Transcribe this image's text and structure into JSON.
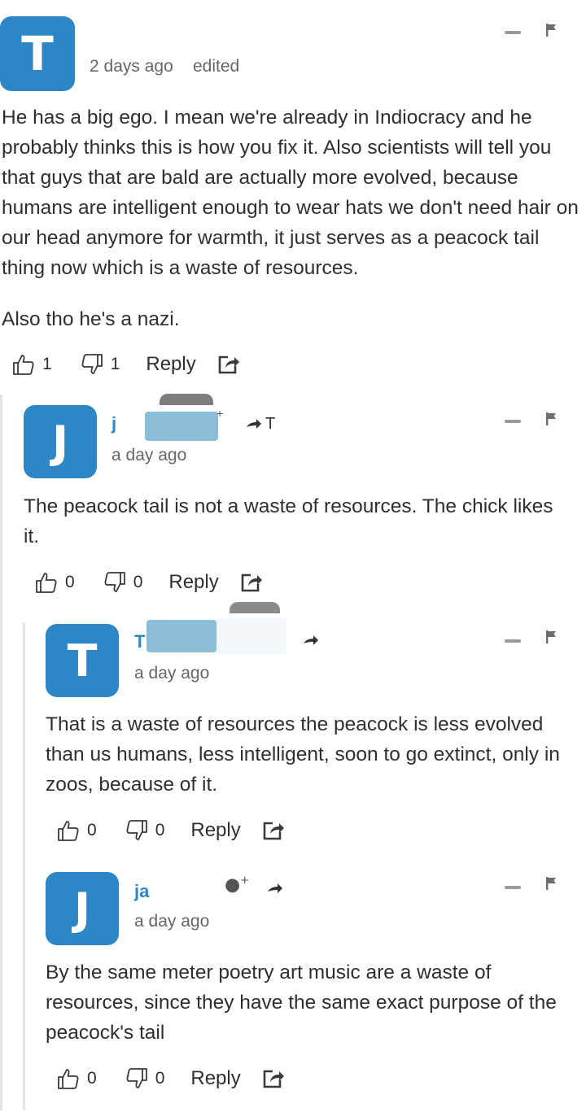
{
  "comments": [
    {
      "avatar_letter": "T",
      "author_visible": "",
      "time": "2 days ago",
      "edited": "edited",
      "body": [
        "He has a big ego. I mean we're already in Indiocracy and he probably thinks this is how you fix it. Also scientists will tell you that guys that are bald are actually more evolved, because humans are intelligent enough to wear hats we don't need hair on our head anymore for warmth, it just serves as a peacock tail thing now which is a waste of resources.",
        "Also tho he's a nazi."
      ],
      "upvotes": "1",
      "downvotes": "1",
      "reply_label": "Reply"
    },
    {
      "avatar_letter": "J",
      "author_visible": "j",
      "reply_to": "T",
      "time": "a day ago",
      "body": [
        "The peacock tail is not a waste of resources. The chick likes it."
      ],
      "upvotes": "0",
      "downvotes": "0",
      "reply_label": "Reply"
    },
    {
      "avatar_letter": "T",
      "author_visible": "T",
      "time": "a day ago",
      "body": [
        "That is a waste of resources the peacock is less evolved than us humans, less intelligent, soon to go extinct, only in zoos, because of it."
      ],
      "upvotes": "0",
      "downvotes": "0",
      "reply_label": "Reply"
    },
    {
      "avatar_letter": "J",
      "author_visible": "ja",
      "time": "a day ago",
      "body": [
        "By the same meter poetry art music are a waste of resources, since they have the same exact purpose of the peacock's tail"
      ],
      "upvotes": "0",
      "downvotes": "0",
      "reply_label": "Reply"
    }
  ],
  "icons": {
    "thumb_up": "thumb-up-icon",
    "thumb_down": "thumb-down-icon",
    "share": "share-icon",
    "reply_arrow": "reply-arrow-icon",
    "follow": "follow-user-icon",
    "collapse": "minus-icon",
    "flag": "flag-icon"
  },
  "colors": {
    "avatar": "#2d87c6",
    "author": "#2d87c6",
    "rail": "#e3e3e3"
  }
}
